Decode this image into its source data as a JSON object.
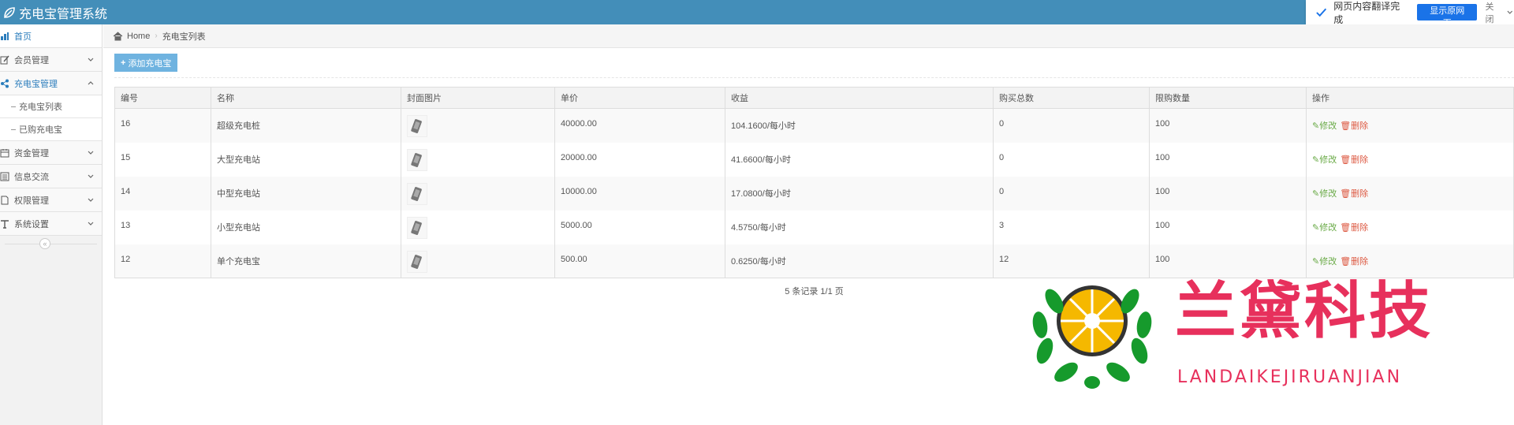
{
  "app": {
    "title": "充电宝管理系统"
  },
  "translate": {
    "message": "网页内容翻译完成",
    "show_original": "显示原网页",
    "close": "关闭"
  },
  "sidebar": {
    "items": [
      {
        "label": "首页",
        "icon": "dashboard-icon",
        "active": true
      },
      {
        "label": "会员管理",
        "icon": "pencil-icon"
      },
      {
        "label": "充电宝管理",
        "icon": "share-icon",
        "open": true
      },
      {
        "label": "资金管理",
        "icon": "calendar-icon"
      },
      {
        "label": "信息交流",
        "icon": "list-icon"
      },
      {
        "label": "权限管理",
        "icon": "file-icon"
      },
      {
        "label": "系统设置",
        "icon": "text-icon"
      }
    ],
    "subitems": [
      {
        "label": "充电宝列表"
      },
      {
        "label": "已购充电宝"
      }
    ],
    "collapse_glyph": "«"
  },
  "breadcrumb": {
    "home": "Home",
    "current": "充电宝列表",
    "separator": "›"
  },
  "toolbar": {
    "add_label": "添加充电宝"
  },
  "table": {
    "columns": [
      "编号",
      "名称",
      "封面图片",
      "单价",
      "收益",
      "购买总数",
      "限购数量",
      "操作"
    ],
    "rows": [
      {
        "id": "16",
        "name": "超级充电桩",
        "price": "40000.00",
        "income": "104.1600/每小时",
        "total": "0",
        "limit": "100"
      },
      {
        "id": "15",
        "name": "大型充电站",
        "price": "20000.00",
        "income": "41.6600/每小时",
        "total": "0",
        "limit": "100"
      },
      {
        "id": "14",
        "name": "中型充电站",
        "price": "10000.00",
        "income": "17.0800/每小时",
        "total": "0",
        "limit": "100"
      },
      {
        "id": "13",
        "name": "小型充电站",
        "price": "5000.00",
        "income": "4.5750/每小时",
        "total": "3",
        "limit": "100"
      },
      {
        "id": "12",
        "name": "单个充电宝",
        "price": "500.00",
        "income": "0.6250/每小时",
        "total": "12",
        "limit": "100"
      }
    ],
    "edit_label": "✎修改",
    "delete_label": "🗑删除"
  },
  "pager": {
    "text": "5 条记录 1/1 页"
  },
  "watermark": {
    "title": "兰黛科技",
    "subtitle": "LANDAIKEJIRUANJIAN"
  },
  "colors": {
    "header": "#438eb9",
    "accent": "#2b7dbc",
    "add_button": "#6fb3e0",
    "edit": "#69aa46",
    "delete": "#dd5a43",
    "watermark": "#e7305c"
  }
}
